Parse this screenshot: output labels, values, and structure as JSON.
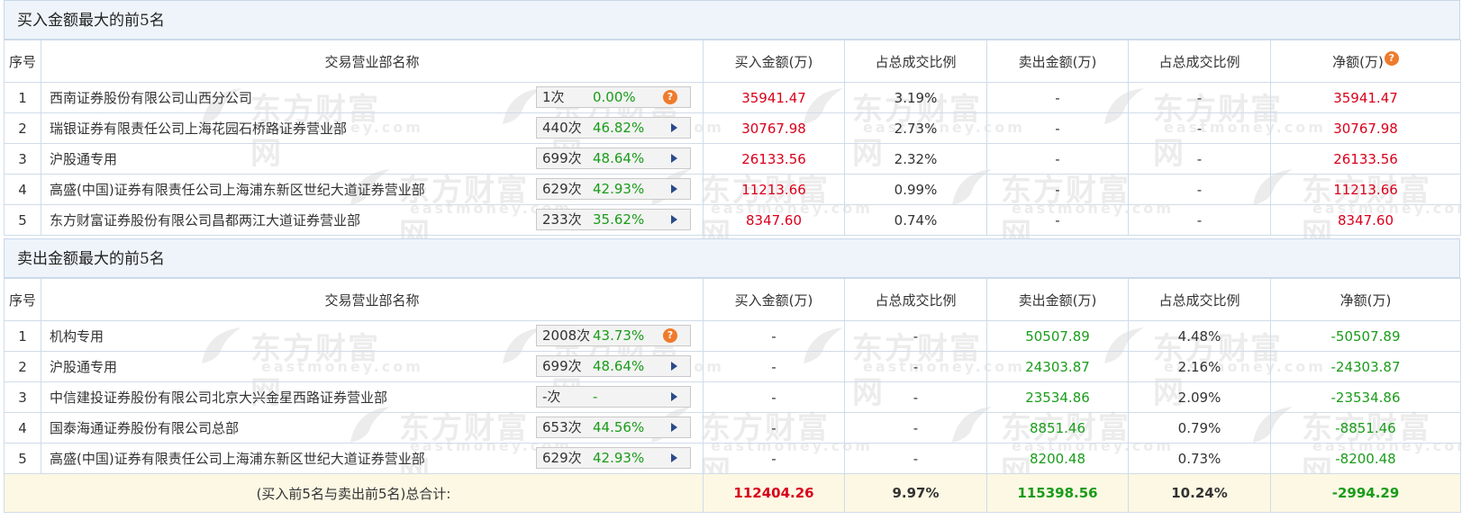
{
  "buy_section": {
    "title": "买入金额最大的前5名",
    "headers": [
      "序号",
      "交易营业部名称",
      "买入金额(万)",
      "占总成交比例",
      "卖出金额(万)",
      "占总成交比例",
      "净额(万)"
    ],
    "rows": [
      {
        "idx": "1",
        "name": "西南证券股份有限公司山西分公司",
        "count": "1次",
        "pct": "0.00%",
        "action": "help",
        "buy": "35941.47",
        "buy_ratio": "3.19%",
        "sell": "-",
        "sell_ratio": "-",
        "net": "35941.47"
      },
      {
        "idx": "2",
        "name": "瑞银证券有限责任公司上海花园石桥路证券营业部",
        "count": "440次",
        "pct": "46.82%",
        "action": "arrow",
        "buy": "30767.98",
        "buy_ratio": "2.73%",
        "sell": "-",
        "sell_ratio": "-",
        "net": "30767.98"
      },
      {
        "idx": "3",
        "name": "沪股通专用",
        "count": "699次",
        "pct": "48.64%",
        "action": "arrow",
        "buy": "26133.56",
        "buy_ratio": "2.32%",
        "sell": "-",
        "sell_ratio": "-",
        "net": "26133.56"
      },
      {
        "idx": "4",
        "name": "高盛(中国)证券有限责任公司上海浦东新区世纪大道证券营业部",
        "count": "629次",
        "pct": "42.93%",
        "action": "arrow",
        "buy": "11213.66",
        "buy_ratio": "0.99%",
        "sell": "-",
        "sell_ratio": "-",
        "net": "11213.66"
      },
      {
        "idx": "5",
        "name": "东方财富证券股份有限公司昌都两江大道证券营业部",
        "count": "233次",
        "pct": "35.62%",
        "action": "arrow",
        "buy": "8347.60",
        "buy_ratio": "0.74%",
        "sell": "-",
        "sell_ratio": "-",
        "net": "8347.60"
      }
    ]
  },
  "sell_section": {
    "title": "卖出金额最大的前5名",
    "headers": [
      "序号",
      "交易营业部名称",
      "买入金额(万)",
      "占总成交比例",
      "卖出金额(万)",
      "占总成交比例",
      "净额(万)"
    ],
    "rows": [
      {
        "idx": "1",
        "name": "机构专用",
        "count": "2008次",
        "pct": "43.73%",
        "action": "help",
        "buy": "-",
        "buy_ratio": "-",
        "sell": "50507.89",
        "sell_ratio": "4.48%",
        "net": "-50507.89"
      },
      {
        "idx": "2",
        "name": "沪股通专用",
        "count": "699次",
        "pct": "48.64%",
        "action": "arrow",
        "buy": "-",
        "buy_ratio": "-",
        "sell": "24303.87",
        "sell_ratio": "2.16%",
        "net": "-24303.87"
      },
      {
        "idx": "3",
        "name": "中信建投证券股份有限公司北京大兴金星西路证券营业部",
        "count": "-次",
        "pct": "-",
        "action": "arrow",
        "buy": "-",
        "buy_ratio": "-",
        "sell": "23534.86",
        "sell_ratio": "2.09%",
        "net": "-23534.86"
      },
      {
        "idx": "4",
        "name": "国泰海通证券股份有限公司总部",
        "count": "653次",
        "pct": "44.56%",
        "action": "arrow",
        "buy": "-",
        "buy_ratio": "-",
        "sell": "8851.46",
        "sell_ratio": "0.79%",
        "net": "-8851.46"
      },
      {
        "idx": "5",
        "name": "高盛(中国)证券有限责任公司上海浦东新区世纪大道证券营业部",
        "count": "629次",
        "pct": "42.93%",
        "action": "arrow",
        "buy": "-",
        "buy_ratio": "-",
        "sell": "8200.48",
        "sell_ratio": "0.73%",
        "net": "-8200.48"
      }
    ]
  },
  "total": {
    "label": "(买入前5名与卖出前5名)总合计:",
    "buy": "112404.26",
    "buy_ratio": "9.97%",
    "sell": "115398.56",
    "sell_ratio": "10.24%",
    "net": "-2994.29"
  },
  "watermark": {
    "cn": "东方财富网",
    "en": "eastmoney.com"
  },
  "icons": {
    "help": "question-circle-icon",
    "arrow": "triangle-right-icon"
  },
  "colors": {
    "buy": "#d9001b",
    "sell": "#1a9c1a",
    "header_bg": "#eef4fa",
    "total_bg": "#fdf8e4",
    "help_icon": "#ef7b2c",
    "arrow_icon": "#2b4a8c"
  }
}
